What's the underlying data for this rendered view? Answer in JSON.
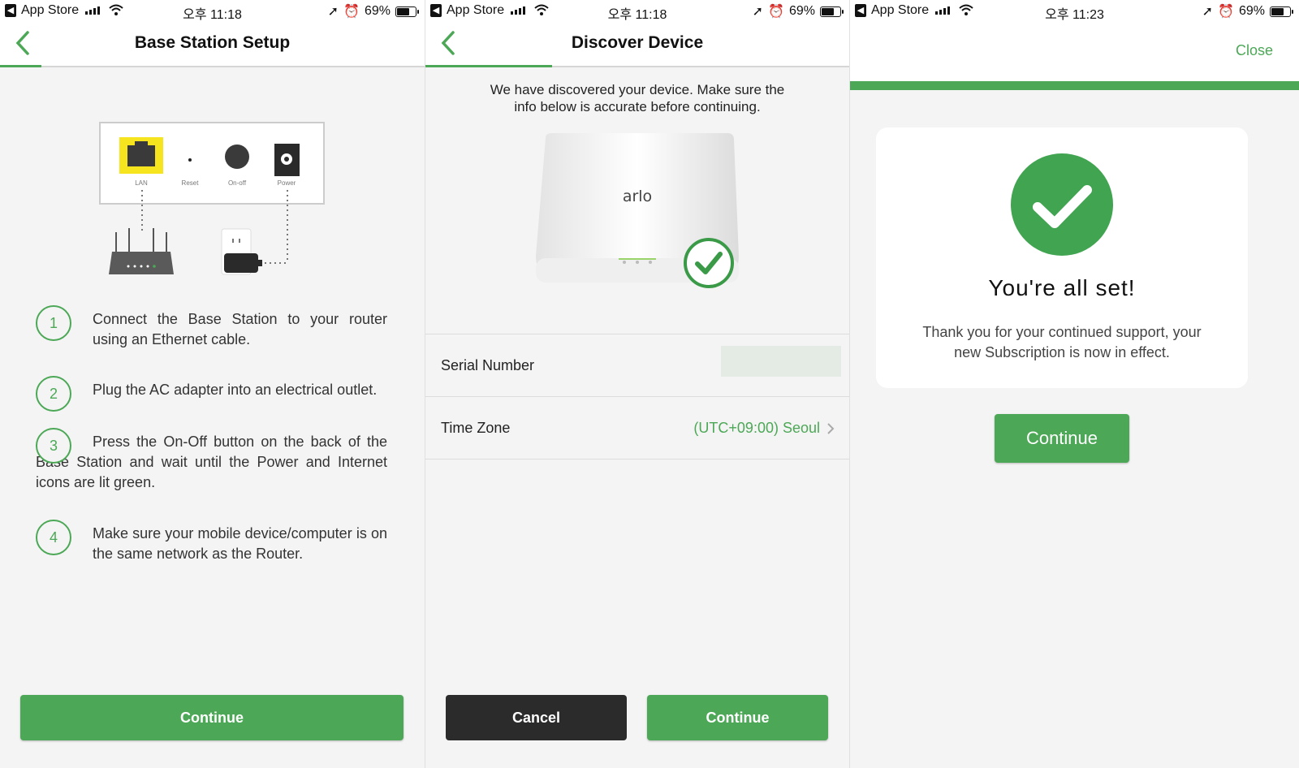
{
  "status_bars": [
    {
      "app": "App Store",
      "time": "오후 11:18",
      "battery": "69%",
      "battery_level": 0.69
    },
    {
      "app": "App Store",
      "time": "오후 11:18",
      "battery": "69%",
      "battery_level": 0.69
    },
    {
      "app": "App Store",
      "time": "오후 11:23",
      "battery": "69%",
      "battery_level": 0.69
    }
  ],
  "screen1": {
    "title": "Base Station Setup",
    "diagram_labels": {
      "lan": "LAN",
      "reset": "Reset",
      "onoff": "On-off",
      "power": "Power"
    },
    "steps": [
      {
        "num": "1",
        "text": "Connect the Base Station to your router using an Ethernet cable."
      },
      {
        "num": "2",
        "text": "Plug the AC adapter into an electrical outlet."
      },
      {
        "num": "3",
        "text": "Press the On-Off button on the back of the Base Station and wait until the Power and Internet icons are lit green."
      },
      {
        "num": "4",
        "text": "Make sure your mobile device/computer is on the same network as the Router."
      }
    ],
    "continue_label": "Continue"
  },
  "screen2": {
    "title": "Discover Device",
    "message": "We have discovered your device. Make sure the info below is accurate before continuing.",
    "device_brand": "arlo",
    "serial_label": "Serial Number",
    "timezone_label": "Time Zone",
    "timezone_value": "(UTC+09:00) Seoul",
    "cancel_label": "Cancel",
    "continue_label": "Continue"
  },
  "screen3": {
    "close_label": "Close",
    "heading": "You're all set!",
    "message": "Thank you for your continued support, your new Subscription is now in effect.",
    "continue_label": "Continue"
  },
  "colors": {
    "accent": "#4ca856",
    "dark_button": "#2b2b2b",
    "background": "#f4f4f4"
  }
}
